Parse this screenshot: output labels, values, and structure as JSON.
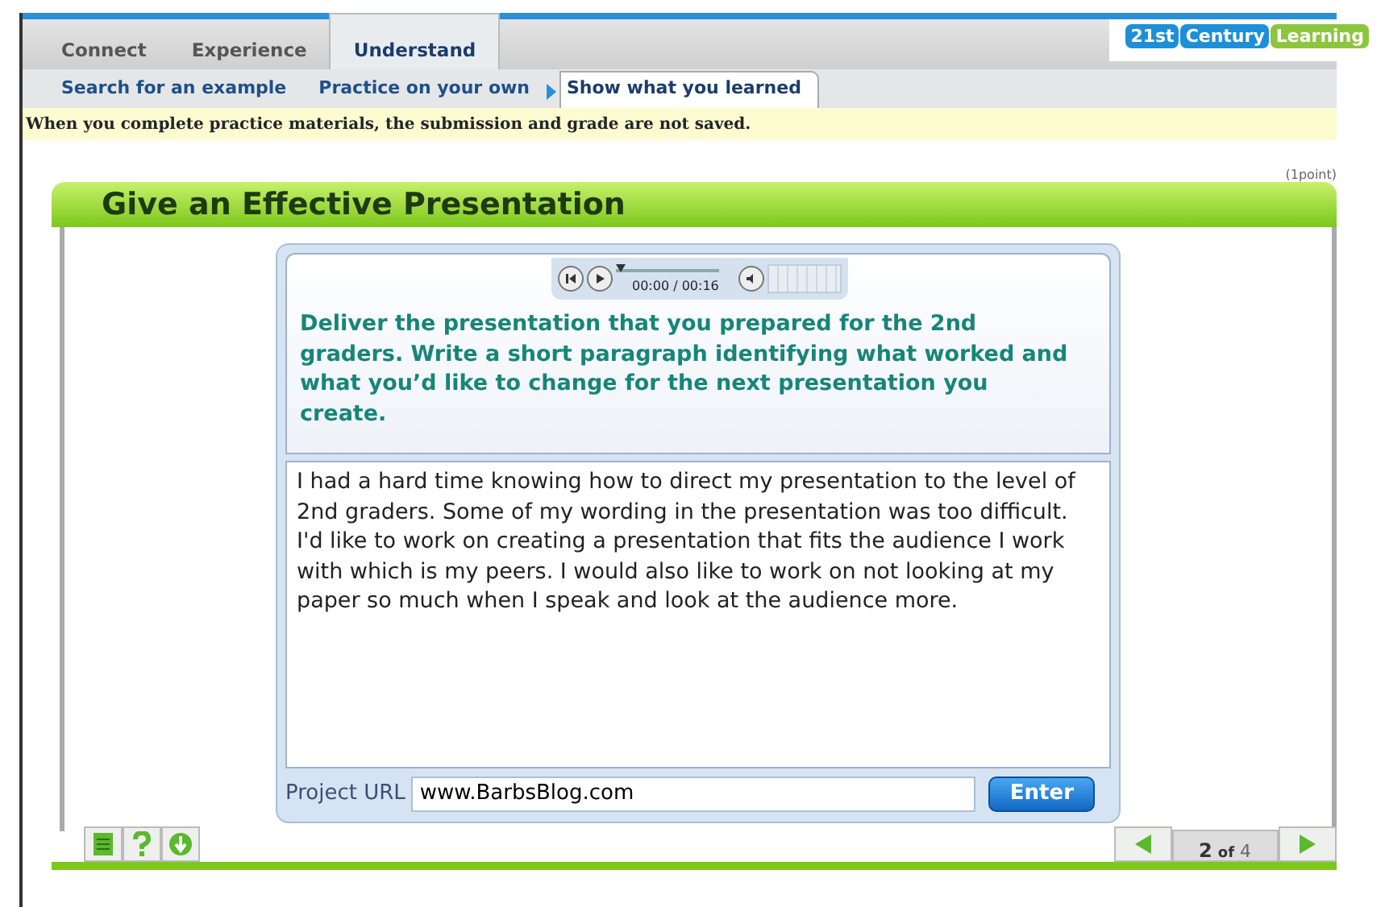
{
  "tabs": [
    {
      "label": "Connect",
      "selected": false
    },
    {
      "label": "Experience",
      "selected": false
    },
    {
      "label": "Understand",
      "selected": true
    }
  ],
  "logo": [
    {
      "text": "21st",
      "color": "#1e8fd6"
    },
    {
      "text": "Century",
      "color": "#1e8fd6"
    },
    {
      "text": "Learning",
      "color": "#8cc63f"
    }
  ],
  "subtabs": [
    {
      "label": "Search for an example",
      "selected": false
    },
    {
      "label": "Practice on your own",
      "selected": false
    },
    {
      "label": "Show what you learned",
      "selected": true
    }
  ],
  "notice": "When you complete practice materials, the submission and grade are not saved.",
  "points": "(1point)",
  "title": "Give an Effective Presentation",
  "player": {
    "time": "00:00 / 00:16",
    "level": 0
  },
  "prompt": "Deliver the presentation that you prepared for the 2nd graders. Write a short paragraph identifying what worked and what you’d like to change for the next presentation you create.",
  "answer": "I had a hard time knowing how to direct my presentation to the level of 2nd graders. Some of my wording in the presentation was too difficult. I'd like to work on creating a presentation that fits the audience I work with which is my peers. I would also like to work on not looking at my paper so much when I speak and look at the audience more.",
  "url": {
    "label": "Project URL",
    "value": "www.BarbsBlog.com",
    "button": "Enter"
  },
  "pager": {
    "current": "2",
    "of": "of",
    "total": "4"
  }
}
